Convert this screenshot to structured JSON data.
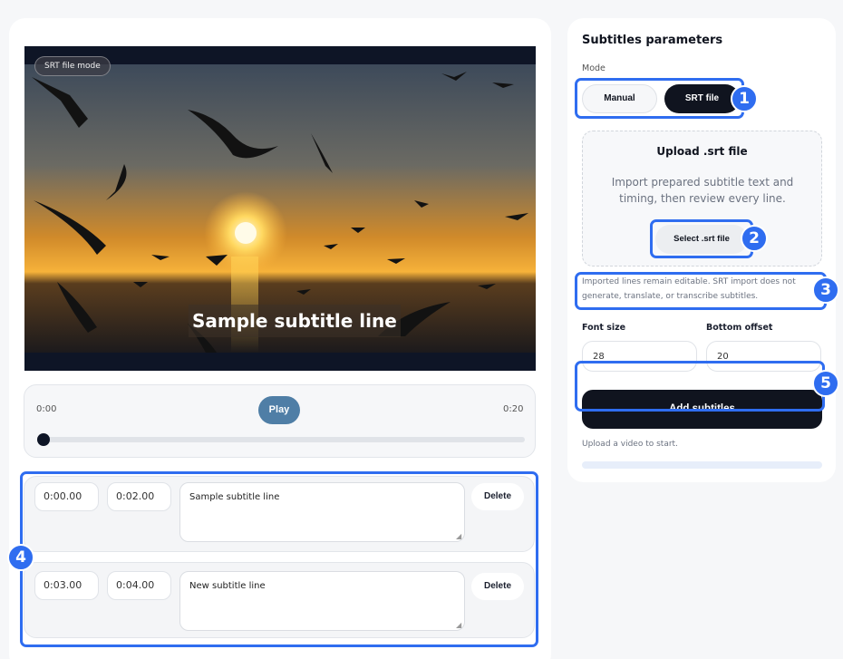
{
  "video": {
    "mode_chip": "SRT file mode",
    "subtitle_overlay": "Sample subtitle line"
  },
  "player": {
    "time_start": "0:00",
    "time_end": "0:20",
    "play_label": "Play",
    "progress_fraction": 0
  },
  "cues": [
    {
      "start": "0:00.00",
      "end": "0:02.00",
      "text": "Sample subtitle line",
      "delete_label": "Delete"
    },
    {
      "start": "0:03.00",
      "end": "0:04.00",
      "text": "New subtitle line",
      "delete_label": "Delete"
    }
  ],
  "panel": {
    "title": "Subtitles parameters",
    "mode_label": "Mode",
    "mode_options": [
      "Manual",
      "SRT file"
    ],
    "selected_mode": "SRT file",
    "upload_title": "Upload .srt file",
    "upload_desc": "Import prepared subtitle text and timing, then review every line.",
    "select_button": "Select .srt file",
    "hint": "Imported lines remain editable. SRT import does not generate, translate, or transcribe subtitles.",
    "font_size_label": "Font size",
    "font_size_value": "28",
    "bottom_offset_label": "Bottom offset",
    "bottom_offset_value": "20",
    "add_button": "Add subtitles",
    "status": "Upload a video to start."
  },
  "annotations": [
    "1",
    "2",
    "3",
    "4",
    "5"
  ],
  "colors": {
    "accent": "#2f6df0",
    "dark": "#10141f",
    "play": "#4f7ea6"
  }
}
